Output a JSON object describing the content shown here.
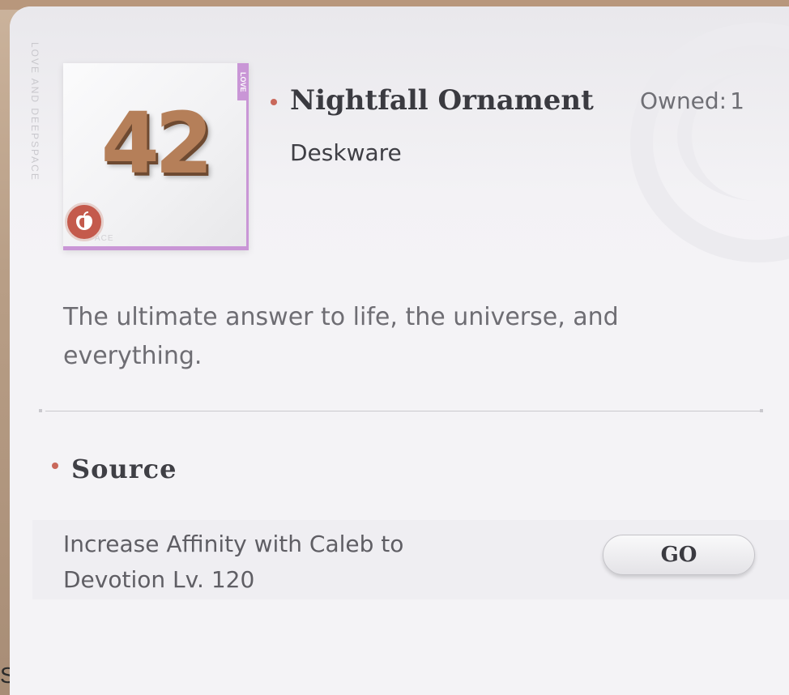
{
  "background": {
    "edge_glyph": "S"
  },
  "brand": {
    "vertical_text": "LOVE AND DEEPSPACE"
  },
  "item": {
    "image_number": "42",
    "rarity_tag": "LOVE",
    "watermark": "PACE",
    "badge_icon": "affinity-apple-icon",
    "name": "Nightfall Ornament",
    "category": "Deskware",
    "owned_label": "Owned:",
    "owned_count": "1",
    "description": "The ultimate answer to life, the universe, and everything."
  },
  "source": {
    "title": "Source",
    "requirement": "Increase Affinity with Caleb to Devotion Lv. 120",
    "go_label": "GO"
  },
  "colors": {
    "accent_dot": "#c9685b",
    "rarity_purple": "#c996d6",
    "badge_red": "#c45a4c",
    "panel_bg": "#f4f3f6"
  }
}
